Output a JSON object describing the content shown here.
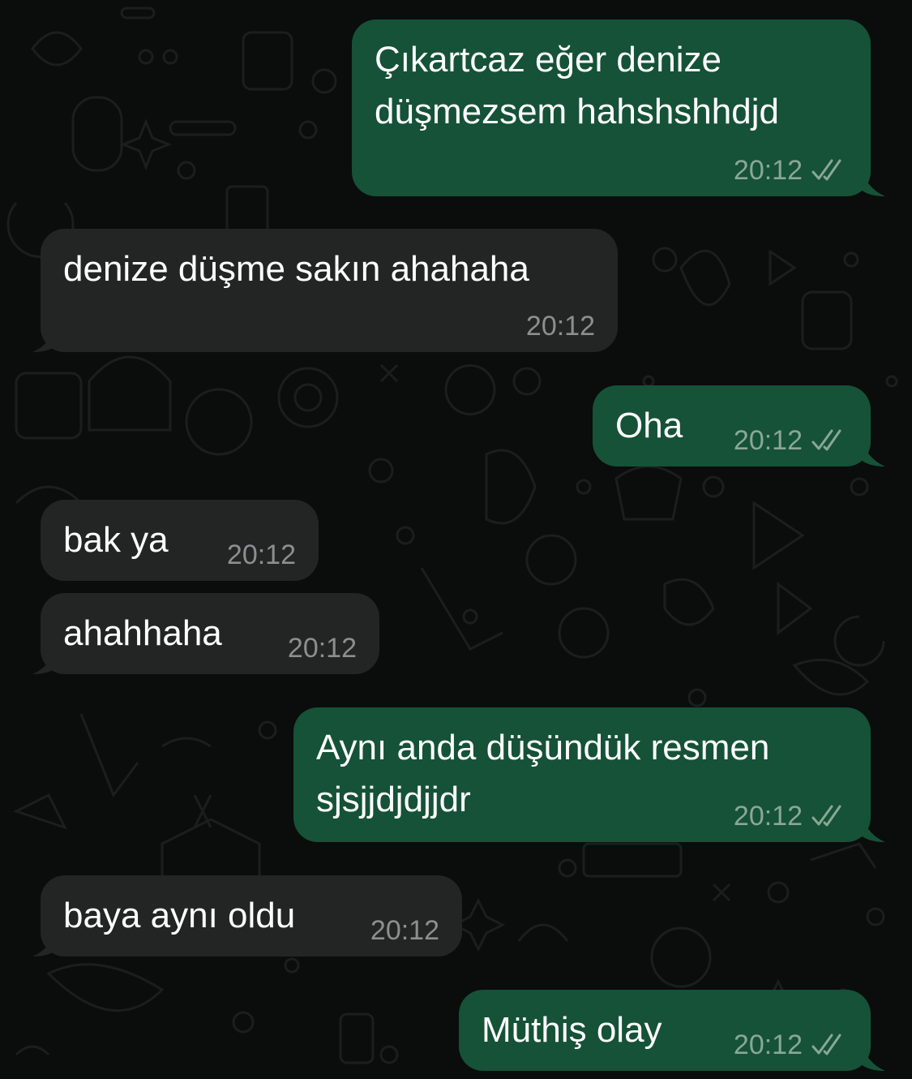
{
  "colors": {
    "outgoing_bubble": "#155237",
    "incoming_bubble": "#232525",
    "background": "#0b0c0c",
    "message_text": "#ffffff",
    "outgoing_meta": "#8aa796",
    "incoming_meta": "#8c8f8f"
  },
  "messages": [
    {
      "direction": "outgoing",
      "text": "Çıkartcaz eğer denize\ndüşmezsem hahshshhdjd",
      "time": "20:12",
      "status_icon": "double-check-icon"
    },
    {
      "direction": "incoming",
      "text": "denize düşme sakın ahahaha",
      "time": "20:12"
    },
    {
      "direction": "outgoing",
      "text": "Oha",
      "time": "20:12",
      "status_icon": "double-check-icon"
    },
    {
      "direction": "incoming",
      "text": "bak ya",
      "time": "20:12"
    },
    {
      "direction": "incoming",
      "text": "ahahhaha",
      "time": "20:12"
    },
    {
      "direction": "outgoing",
      "text": "Aynı anda düşündük resmen\nsjsjjdjdjjdr",
      "time": "20:12",
      "status_icon": "double-check-icon"
    },
    {
      "direction": "incoming",
      "text": "baya aynı oldu",
      "time": "20:12"
    },
    {
      "direction": "outgoing",
      "text": "Müthiş olay",
      "time": "20:12",
      "status_icon": "double-check-icon"
    }
  ]
}
